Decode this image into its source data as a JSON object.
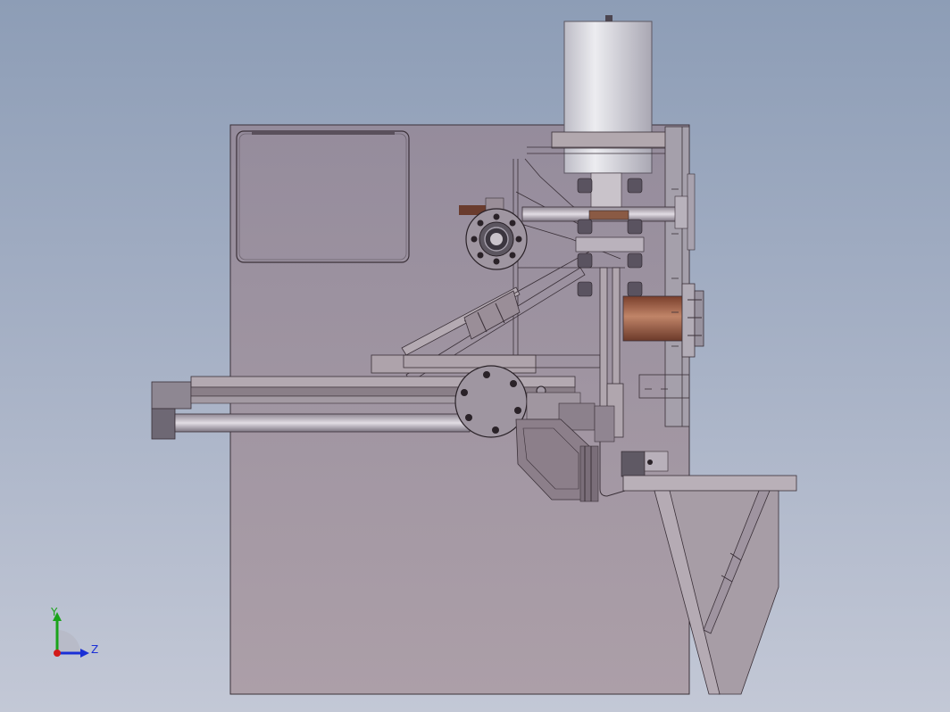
{
  "viewport": {
    "background_top": "#8d9db6",
    "background_bottom": "#c3c8d6"
  },
  "model": {
    "description": "machine-assembly",
    "colors": {
      "frame": "#a69da8",
      "frame_edge": "#3a3038",
      "cylinder": "#cfcfd6",
      "motor": "#9a5a3e",
      "axle": "#a39ca8"
    }
  },
  "triad": {
    "y_label": "Y",
    "z_label": "Z",
    "y_color": "#1aa31a",
    "z_color": "#1a2fd6",
    "x_color": "#d21a1a"
  }
}
